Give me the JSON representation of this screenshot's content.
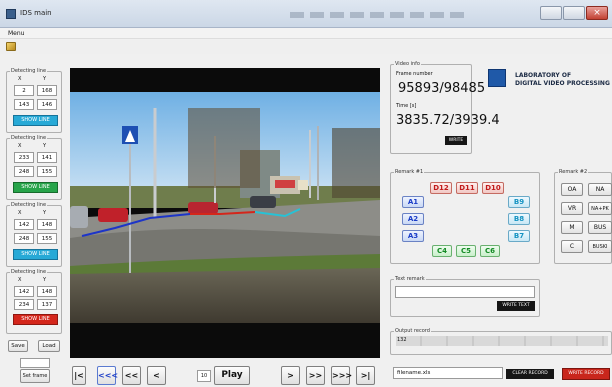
{
  "window": {
    "title": "IDS main"
  },
  "menu": {
    "label": "Menu"
  },
  "lines": [
    {
      "legend": "Detecting line",
      "x_label": "X",
      "y_label": "Y",
      "x1": "2",
      "y1": "168",
      "x2": "143",
      "y2": "146",
      "button": "SHOW LINE",
      "color": "#27a9d6"
    },
    {
      "legend": "Detecting line",
      "x_label": "X",
      "y_label": "Y",
      "x1": "233",
      "y1": "141",
      "x2": "248",
      "y2": "155",
      "button": "SHOW LINE",
      "color": "#27a44a"
    },
    {
      "legend": "Detecting line",
      "x_label": "X",
      "y_label": "Y",
      "x1": "142",
      "y1": "148",
      "x2": "248",
      "y2": "155",
      "button": "SHOW LINE",
      "color": "#27a9d6"
    },
    {
      "legend": "Detecting line",
      "x_label": "X",
      "y_label": "Y",
      "x1": "142",
      "y1": "148",
      "x2": "234",
      "y2": "137",
      "button": "SHOW LINE",
      "color": "#d4261b"
    }
  ],
  "left_buttons": {
    "save": "Save",
    "load": "Load",
    "set_frame": "Set frame"
  },
  "playback": {
    "first": "|<",
    "rewind_fast": "<<<",
    "rewind": "<<",
    "step_back": "<",
    "frame_step": "10",
    "play": "Play",
    "step_fwd": ">",
    "fwd": ">>",
    "fwd_fast": ">>>",
    "last": ">|"
  },
  "video_info": {
    "legend": "Video info",
    "frame_label": "Frame number",
    "frame_value": "95893/98485",
    "time_label": "Time [s]",
    "time_value": "3835.72/3939.4",
    "write": "WRITE"
  },
  "lab": {
    "name": "LABORATORY OF\nDIGITAL VIDEO PROCESSING"
  },
  "remark1": {
    "legend": "Remark #1",
    "d_buttons": [
      "D12",
      "D11",
      "D10"
    ],
    "a_buttons": [
      "A1",
      "A2",
      "A3"
    ],
    "b_buttons": [
      "B9",
      "B8",
      "B7"
    ],
    "c_buttons": [
      "C4",
      "C5",
      "C6"
    ]
  },
  "remark2": {
    "legend": "Remark #2",
    "buttons": [
      "OA",
      "NA",
      "VR",
      "NA+PK",
      "M",
      "BUS",
      "C",
      "BUSKI"
    ]
  },
  "text_remark": {
    "legend": "Text remark",
    "value": "",
    "write": "WRITE TEXT"
  },
  "output": {
    "legend": "Output record",
    "value": "132",
    "filename": "filename.xls",
    "clear": "CLEAR RECORD",
    "write": "WRITE RECORD"
  }
}
